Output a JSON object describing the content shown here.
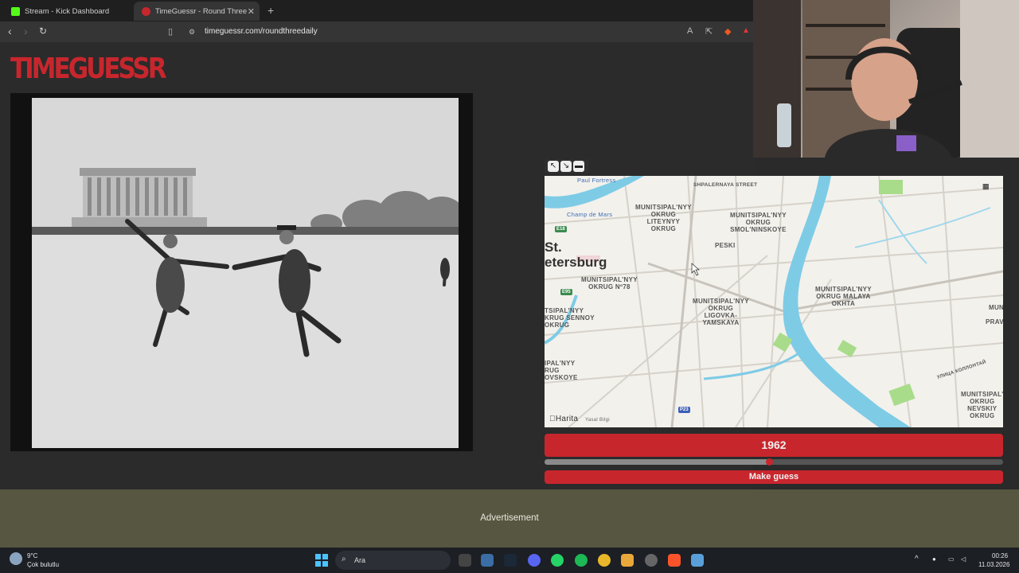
{
  "browser": {
    "tabs": [
      {
        "label": "Stream - Kick Dashboard",
        "active": false
      },
      {
        "label": "TimeGuessr - Round Three",
        "active": true
      }
    ],
    "url": "timeguessr.com/roundthreedaily"
  },
  "page": {
    "logo": "TIMEGUESSR",
    "year_value": "1962",
    "guess_label": "Make guess",
    "slider_fraction": 0.49,
    "advertisement_label": "Advertisement"
  },
  "map": {
    "labels": {
      "paul_fortress": "Paul Fortress",
      "champ_de_mars": "Champ de Mars",
      "shpalernaya": "SHPALERNAYA STREET",
      "liteyny": "MUNITSIPAL'NYY\nOKRUG\nLITEYNYY\nOKRUG",
      "smolninskoye": "MUNITSIPAL'NYY\nOKRUG\nSMOL'NINSKOYE",
      "peski": "PESKI",
      "st_petersburg": "St.\netersburg",
      "okrug78": "MUNITSIPAL'NYY\nOKRUG Nº78",
      "ligovka": "MUNITSIPAL'NYY\nOKRUG\nLIGOVKA-\nYAMSKAYA",
      "malaya_okhta": "MUNITSIPAL'NYY\nOKRUG MALAYA\nOKHTA",
      "sennoy": "TSIPAL'NYY\nKRUG SENNOY\nOKRUG",
      "ovskoye": "IPAL'NYY\nRUG\nOVSKOYE",
      "nevskiy": "MUNITSIPAL'\nOKRUG\nNEVSKIY\nOKRUG",
      "mun_right": "MUN",
      "prav": "PRAV",
      "kollontay": "УЛИЦА КОЛЛОНТАЙ",
      "harita": "Harita",
      "yasal": "Yasal Bilgi"
    },
    "road_signs": {
      "e18": "E18",
      "e95": "E95",
      "p23": "P23"
    },
    "accent_colors": {
      "water": "#7ecbe6",
      "park": "#a8dc8a",
      "road": "#d4d0c8"
    }
  },
  "taskbar": {
    "weather_temp": "9°C",
    "weather_desc": "Çok bulutlu",
    "search_placeholder": "Ara",
    "time": "00:26",
    "date": "11.03.2026"
  },
  "colors": {
    "brand_red": "#c8262d",
    "ad_bg": "#575640"
  }
}
